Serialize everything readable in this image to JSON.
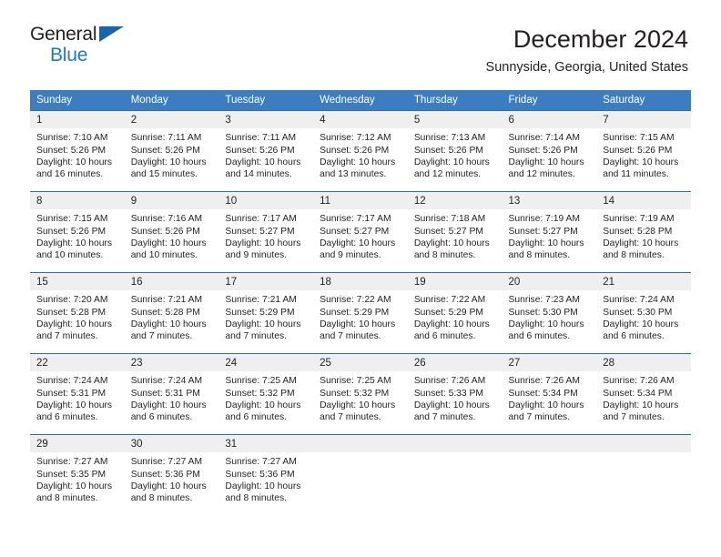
{
  "brand": {
    "name_top": "General",
    "name_bottom": "Blue",
    "flag_icon": "triangle-flag-icon",
    "accent_color": "#1f7ac4"
  },
  "header": {
    "month_title": "December 2024",
    "location": "Sunnyside, Georgia, United States"
  },
  "calendar": {
    "header_bg": "#3b7dc0",
    "row_divider_color": "#2c6fb5",
    "daynum_bg": "#efefef",
    "weekday_headers": [
      "Sunday",
      "Monday",
      "Tuesday",
      "Wednesday",
      "Thursday",
      "Friday",
      "Saturday"
    ],
    "weeks": [
      [
        {
          "day": "1",
          "sunrise": "Sunrise: 7:10 AM",
          "sunset": "Sunset: 5:26 PM",
          "daylight_line1": "Daylight: 10 hours",
          "daylight_line2": "and 16 minutes."
        },
        {
          "day": "2",
          "sunrise": "Sunrise: 7:11 AM",
          "sunset": "Sunset: 5:26 PM",
          "daylight_line1": "Daylight: 10 hours",
          "daylight_line2": "and 15 minutes."
        },
        {
          "day": "3",
          "sunrise": "Sunrise: 7:11 AM",
          "sunset": "Sunset: 5:26 PM",
          "daylight_line1": "Daylight: 10 hours",
          "daylight_line2": "and 14 minutes."
        },
        {
          "day": "4",
          "sunrise": "Sunrise: 7:12 AM",
          "sunset": "Sunset: 5:26 PM",
          "daylight_line1": "Daylight: 10 hours",
          "daylight_line2": "and 13 minutes."
        },
        {
          "day": "5",
          "sunrise": "Sunrise: 7:13 AM",
          "sunset": "Sunset: 5:26 PM",
          "daylight_line1": "Daylight: 10 hours",
          "daylight_line2": "and 12 minutes."
        },
        {
          "day": "6",
          "sunrise": "Sunrise: 7:14 AM",
          "sunset": "Sunset: 5:26 PM",
          "daylight_line1": "Daylight: 10 hours",
          "daylight_line2": "and 12 minutes."
        },
        {
          "day": "7",
          "sunrise": "Sunrise: 7:15 AM",
          "sunset": "Sunset: 5:26 PM",
          "daylight_line1": "Daylight: 10 hours",
          "daylight_line2": "and 11 minutes."
        }
      ],
      [
        {
          "day": "8",
          "sunrise": "Sunrise: 7:15 AM",
          "sunset": "Sunset: 5:26 PM",
          "daylight_line1": "Daylight: 10 hours",
          "daylight_line2": "and 10 minutes."
        },
        {
          "day": "9",
          "sunrise": "Sunrise: 7:16 AM",
          "sunset": "Sunset: 5:26 PM",
          "daylight_line1": "Daylight: 10 hours",
          "daylight_line2": "and 10 minutes."
        },
        {
          "day": "10",
          "sunrise": "Sunrise: 7:17 AM",
          "sunset": "Sunset: 5:27 PM",
          "daylight_line1": "Daylight: 10 hours",
          "daylight_line2": "and 9 minutes."
        },
        {
          "day": "11",
          "sunrise": "Sunrise: 7:17 AM",
          "sunset": "Sunset: 5:27 PM",
          "daylight_line1": "Daylight: 10 hours",
          "daylight_line2": "and 9 minutes."
        },
        {
          "day": "12",
          "sunrise": "Sunrise: 7:18 AM",
          "sunset": "Sunset: 5:27 PM",
          "daylight_line1": "Daylight: 10 hours",
          "daylight_line2": "and 8 minutes."
        },
        {
          "day": "13",
          "sunrise": "Sunrise: 7:19 AM",
          "sunset": "Sunset: 5:27 PM",
          "daylight_line1": "Daylight: 10 hours",
          "daylight_line2": "and 8 minutes."
        },
        {
          "day": "14",
          "sunrise": "Sunrise: 7:19 AM",
          "sunset": "Sunset: 5:28 PM",
          "daylight_line1": "Daylight: 10 hours",
          "daylight_line2": "and 8 minutes."
        }
      ],
      [
        {
          "day": "15",
          "sunrise": "Sunrise: 7:20 AM",
          "sunset": "Sunset: 5:28 PM",
          "daylight_line1": "Daylight: 10 hours",
          "daylight_line2": "and 7 minutes."
        },
        {
          "day": "16",
          "sunrise": "Sunrise: 7:21 AM",
          "sunset": "Sunset: 5:28 PM",
          "daylight_line1": "Daylight: 10 hours",
          "daylight_line2": "and 7 minutes."
        },
        {
          "day": "17",
          "sunrise": "Sunrise: 7:21 AM",
          "sunset": "Sunset: 5:29 PM",
          "daylight_line1": "Daylight: 10 hours",
          "daylight_line2": "and 7 minutes."
        },
        {
          "day": "18",
          "sunrise": "Sunrise: 7:22 AM",
          "sunset": "Sunset: 5:29 PM",
          "daylight_line1": "Daylight: 10 hours",
          "daylight_line2": "and 7 minutes."
        },
        {
          "day": "19",
          "sunrise": "Sunrise: 7:22 AM",
          "sunset": "Sunset: 5:29 PM",
          "daylight_line1": "Daylight: 10 hours",
          "daylight_line2": "and 6 minutes."
        },
        {
          "day": "20",
          "sunrise": "Sunrise: 7:23 AM",
          "sunset": "Sunset: 5:30 PM",
          "daylight_line1": "Daylight: 10 hours",
          "daylight_line2": "and 6 minutes."
        },
        {
          "day": "21",
          "sunrise": "Sunrise: 7:24 AM",
          "sunset": "Sunset: 5:30 PM",
          "daylight_line1": "Daylight: 10 hours",
          "daylight_line2": "and 6 minutes."
        }
      ],
      [
        {
          "day": "22",
          "sunrise": "Sunrise: 7:24 AM",
          "sunset": "Sunset: 5:31 PM",
          "daylight_line1": "Daylight: 10 hours",
          "daylight_line2": "and 6 minutes."
        },
        {
          "day": "23",
          "sunrise": "Sunrise: 7:24 AM",
          "sunset": "Sunset: 5:31 PM",
          "daylight_line1": "Daylight: 10 hours",
          "daylight_line2": "and 6 minutes."
        },
        {
          "day": "24",
          "sunrise": "Sunrise: 7:25 AM",
          "sunset": "Sunset: 5:32 PM",
          "daylight_line1": "Daylight: 10 hours",
          "daylight_line2": "and 6 minutes."
        },
        {
          "day": "25",
          "sunrise": "Sunrise: 7:25 AM",
          "sunset": "Sunset: 5:32 PM",
          "daylight_line1": "Daylight: 10 hours",
          "daylight_line2": "and 7 minutes."
        },
        {
          "day": "26",
          "sunrise": "Sunrise: 7:26 AM",
          "sunset": "Sunset: 5:33 PM",
          "daylight_line1": "Daylight: 10 hours",
          "daylight_line2": "and 7 minutes."
        },
        {
          "day": "27",
          "sunrise": "Sunrise: 7:26 AM",
          "sunset": "Sunset: 5:34 PM",
          "daylight_line1": "Daylight: 10 hours",
          "daylight_line2": "and 7 minutes."
        },
        {
          "day": "28",
          "sunrise": "Sunrise: 7:26 AM",
          "sunset": "Sunset: 5:34 PM",
          "daylight_line1": "Daylight: 10 hours",
          "daylight_line2": "and 7 minutes."
        }
      ],
      [
        {
          "day": "29",
          "sunrise": "Sunrise: 7:27 AM",
          "sunset": "Sunset: 5:35 PM",
          "daylight_line1": "Daylight: 10 hours",
          "daylight_line2": "and 8 minutes."
        },
        {
          "day": "30",
          "sunrise": "Sunrise: 7:27 AM",
          "sunset": "Sunset: 5:36 PM",
          "daylight_line1": "Daylight: 10 hours",
          "daylight_line2": "and 8 minutes."
        },
        {
          "day": "31",
          "sunrise": "Sunrise: 7:27 AM",
          "sunset": "Sunset: 5:36 PM",
          "daylight_line1": "Daylight: 10 hours",
          "daylight_line2": "and 8 minutes."
        },
        {
          "day": "",
          "sunrise": "",
          "sunset": "",
          "daylight_line1": "",
          "daylight_line2": ""
        },
        {
          "day": "",
          "sunrise": "",
          "sunset": "",
          "daylight_line1": "",
          "daylight_line2": ""
        },
        {
          "day": "",
          "sunrise": "",
          "sunset": "",
          "daylight_line1": "",
          "daylight_line2": ""
        },
        {
          "day": "",
          "sunrise": "",
          "sunset": "",
          "daylight_line1": "",
          "daylight_line2": ""
        }
      ]
    ]
  }
}
